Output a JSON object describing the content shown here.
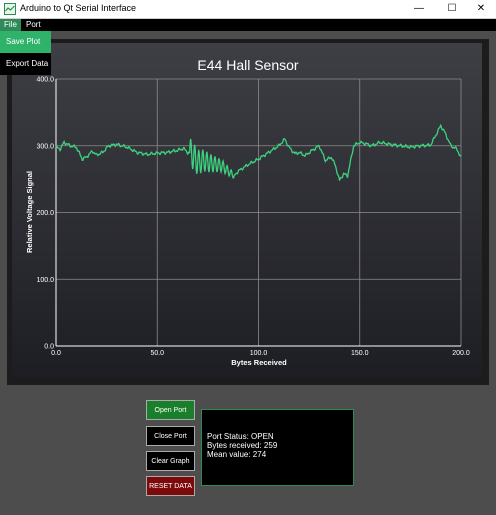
{
  "window": {
    "title": "Arduino to Qt Serial Interface",
    "minimize": "—",
    "maximize": "☐",
    "close": "✕"
  },
  "menu": {
    "file": "File",
    "port": "Port",
    "file_items": [
      "Save Plot",
      "Export Data"
    ]
  },
  "chart_data": {
    "type": "line",
    "title": "E44 Hall Sensor",
    "xlabel": "Bytes Received",
    "ylabel": "Relative Voltage Signal",
    "xlim": [
      0,
      200
    ],
    "ylim": [
      0,
      400
    ],
    "xticks": [
      "0.0",
      "50.0",
      "100.0",
      "150.0",
      "200.0"
    ],
    "yticks": [
      "0.0",
      "100.0",
      "200.0",
      "300.0",
      "400.0"
    ],
    "grid": true,
    "line_color": "#3cd27f",
    "series": [
      {
        "x": [
          0,
          2,
          4,
          7,
          10,
          13,
          15,
          18,
          20,
          23,
          26,
          30,
          35,
          40,
          45,
          50,
          55,
          58,
          60,
          63,
          65,
          67,
          70,
          73,
          76,
          79,
          82,
          85,
          88,
          90,
          95,
          100,
          105,
          110,
          113,
          115,
          118,
          120,
          123,
          126,
          130,
          133,
          136,
          138,
          140,
          142,
          144,
          147,
          150,
          153,
          156,
          160,
          165,
          170,
          175,
          180,
          185,
          190,
          192,
          195,
          198,
          200
        ],
        "y": [
          298,
          295,
          305,
          300,
          298,
          280,
          283,
          292,
          286,
          290,
          300,
          302,
          298,
          290,
          287,
          289,
          290,
          292,
          293,
          296,
          290,
          288,
          275,
          278,
          274,
          272,
          270,
          262,
          255,
          262,
          272,
          280,
          290,
          300,
          310,
          298,
          288,
          290,
          285,
          292,
          300,
          278,
          283,
          270,
          248,
          258,
          255,
          300,
          305,
          303,
          300,
          305,
          302,
          300,
          298,
          300,
          301,
          330,
          320,
          300,
          295,
          282
        ]
      }
    ],
    "oscillation": {
      "x_start": 66,
      "x_end": 88,
      "amplitude_start": 22,
      "amplitude_end": 4
    }
  },
  "buttons": {
    "open_port": "Open Port",
    "close_port": "Close Port",
    "clear_graph": "Clear Graph",
    "reset_data": "RESET DATA"
  },
  "status": {
    "line1": "Port Status: OPEN",
    "line2": "Bytes received: 259",
    "line3": "Mean value: 274"
  },
  "colors": {
    "accent_green": "#2e8b57",
    "open_button": "#1a7f2a",
    "reset_button": "#7d0a0a",
    "dropdown_highlight": "#2fb36b"
  }
}
